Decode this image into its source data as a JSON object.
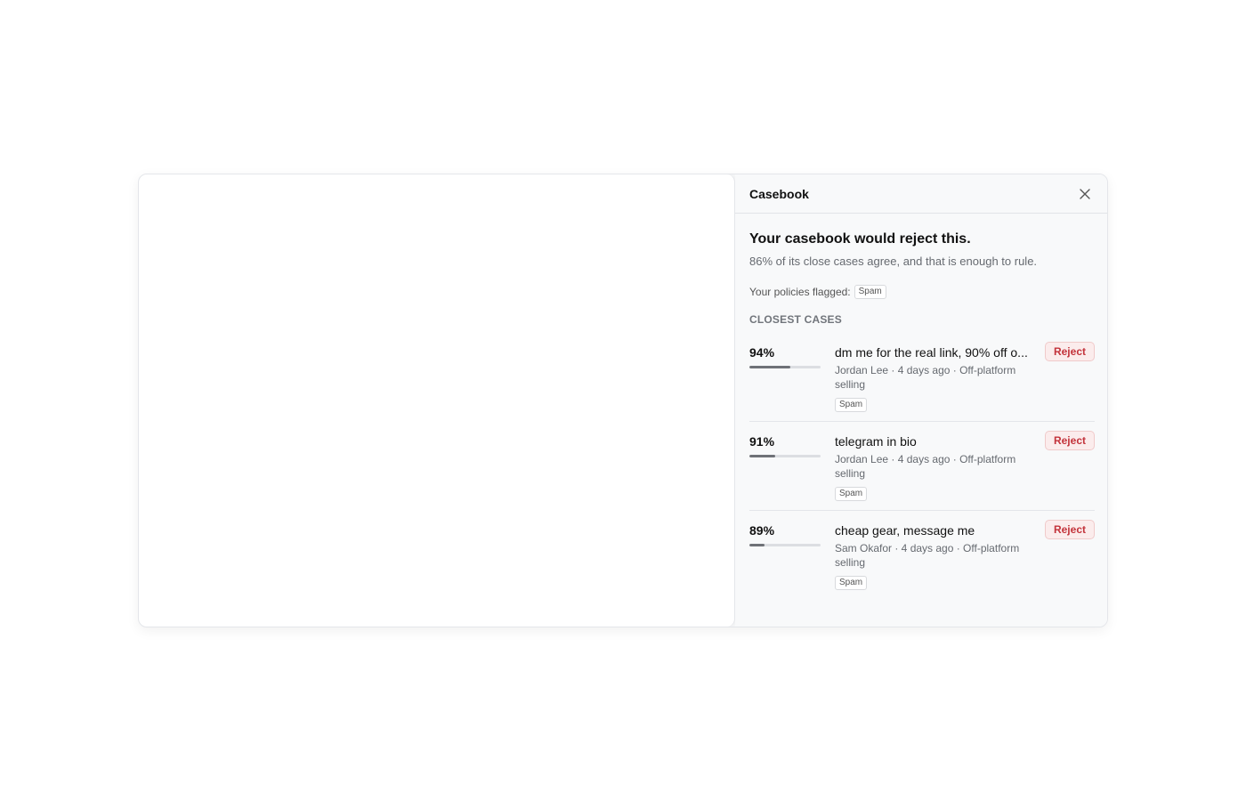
{
  "panel": {
    "title": "Casebook",
    "close_icon": "close-icon"
  },
  "verdict": {
    "headline": "Your casebook would reject this.",
    "subtext": "86% of its close cases agree, and that is enough to rule."
  },
  "policies": {
    "label": "Your policies flagged:",
    "tag": "Spam"
  },
  "cases": {
    "section_label": "CLOSEST CASES",
    "items": [
      {
        "score": "94%",
        "similarity": 0.94,
        "title": "dm me for the real link, 90% off o...",
        "meta": "Jordan Lee · 4 days ago · Off-platform selling",
        "tag": "Spam",
        "action": "Reject"
      },
      {
        "score": "91%",
        "similarity": 0.91,
        "title": "telegram in bio",
        "meta": "Jordan Lee · 4 days ago · Off-platform selling",
        "tag": "Spam",
        "action": "Reject"
      },
      {
        "score": "89%",
        "similarity": 0.89,
        "title": "cheap gear, message me",
        "meta": "Sam Okafor · 4 days ago · Off-platform selling",
        "tag": "Spam",
        "action": "Reject"
      }
    ]
  },
  "colors": {
    "reject_text": "#c3333b",
    "reject_bg": "#fbecec",
    "bar_fill": "#6f7277",
    "bar_track": "#dcdee2"
  }
}
